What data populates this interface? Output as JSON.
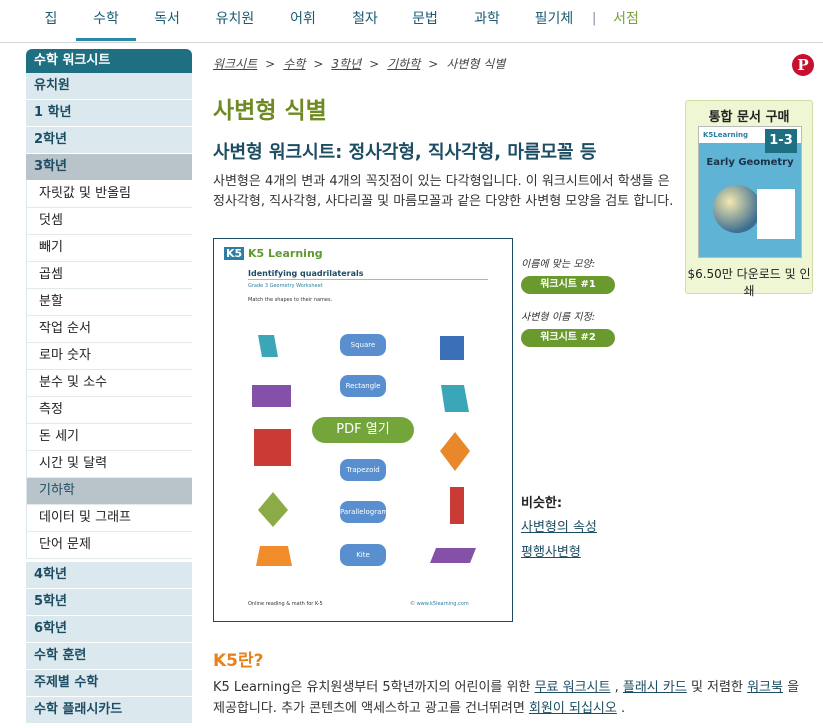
{
  "nav": {
    "items": [
      "집",
      "수학",
      "독서",
      "유치원",
      "어휘",
      "철자",
      "문법",
      "과학",
      "필기체"
    ],
    "separator": "|",
    "store": "서점"
  },
  "sidebar": {
    "header": "수학 워크시트",
    "grades_top": [
      "유치원",
      "1 학년",
      "2학년",
      "3학년"
    ],
    "subitems": [
      "자릿값 및 반올림",
      "덧셈",
      "빼기",
      "곱셈",
      "분할",
      "작업 순서",
      "로마 숫자",
      "분수 및 소수",
      "측정",
      "돈 세기",
      "시간 및 달력",
      "기하학",
      "데이터 및 그래프",
      "단어 문제"
    ],
    "grades_bottom": [
      "4학년",
      "5학년",
      "6학년",
      "수학 훈련",
      "주제별 수학",
      "수학 플래시카드"
    ]
  },
  "breadcrumb": [
    "워크시트",
    "수학",
    "3학년",
    "기하학",
    "사변형 식별"
  ],
  "breadcrumb_sep": ">",
  "pinterest": "P",
  "title": "사변형 식별",
  "subtitle": "사변형 워크시트: 정사각형, 직사각형, 마름모꼴 등",
  "intro": "사변형은 4개의 변과 4개의 꼭짓점이 있는 다각형입니다. 이 워크시트에서 학생들 은 정사각형, 직사각형, 사다리꼴 및 마름모꼴과 같은 다양한 사변형 모양을 검토 합니다.",
  "promo": {
    "title": "통합 문서 구매",
    "book_logo": "K5Learning",
    "book_grade": "1-3",
    "book_title": "Early Geometry",
    "price": "$6.50만 다운로드 및 인쇄"
  },
  "worksheet_preview": {
    "logo": "K5 Learning",
    "title": "Identifying quadrilaterals",
    "subtitle": "Grade 3 Geometry Worksheet",
    "instruction": "Match the shapes to their names.",
    "labels": [
      "Square",
      "Rectangle",
      "Trapezoid",
      "Parallelogram",
      "Kite"
    ],
    "open_pdf": "PDF 열기",
    "footer_left": "Online reading & math for K-5",
    "footer_right": "© www.k5learning.com"
  },
  "worksheet_links": [
    {
      "label": "이름에 맞는 모양:",
      "button": "워크시트 #1"
    },
    {
      "label": "사변형 이름 지정:",
      "button": "워크시트 #2"
    }
  ],
  "similar": {
    "heading": "비슷한:",
    "links": [
      "사변형의 속성",
      "평행사변형"
    ]
  },
  "k5": {
    "heading": "K5란?",
    "text_a": "K5 Learning은 유치원생부터 5학년까지의 어린이를 위한 ",
    "link_a": "무료 워크시트",
    "text_b": " , ",
    "link_b": "플래시 카드",
    "text_c": " 및 저렴한 ",
    "link_c": "워크북",
    "text_d": " 을 제공합니다. 추가 콘텐츠에 액세스하고 광고를 건너뛰려면 ",
    "link_d": "회원이 되십시오",
    "text_e": " ."
  },
  "colors": {
    "accent_blue": "#1e6f82",
    "title_green": "#6f8a23",
    "k5_orange": "#e8831b",
    "button_green": "#6a9a2d"
  }
}
